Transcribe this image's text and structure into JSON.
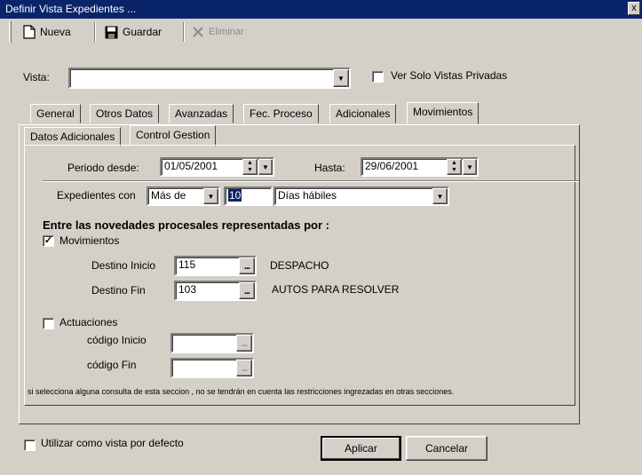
{
  "window": {
    "title": "Definir Vista Expedientes ...",
    "close_glyph": "x"
  },
  "toolbar": {
    "new_label": "Nueva",
    "save_label": "Guardar",
    "delete_label": "Eliminar"
  },
  "vista": {
    "label": "Vista:",
    "value": "",
    "private_only_label": "Ver Solo Vistas Privadas",
    "private_only_checked": false
  },
  "tabs_main": [
    "General",
    "Otros Datos",
    "Avanzadas",
    "Fec. Proceso",
    "Adicionales",
    "Movimientos"
  ],
  "tabs_main_active": "Movimientos",
  "tabs_sub": [
    "Datos Adicionales",
    "Control Gestion"
  ],
  "tabs_sub_active": "Control Gestion",
  "periodo": {
    "desde_label": "Periodo desde:",
    "desde_value": "01/05/2001",
    "hasta_label": "Hasta:",
    "hasta_value": "29/06/2001"
  },
  "expedientes": {
    "label": "Expedientes con",
    "comparator": "Más de",
    "days": "10",
    "day_type": "Días hábiles"
  },
  "novedades": {
    "heading": "Entre las novedades procesales representadas por :"
  },
  "movimientos": {
    "label": "Movimientos",
    "checked": true,
    "inicio_label": "Destino Inicio",
    "inicio_code": "115",
    "inicio_desc": "DESPACHO",
    "fin_label": "Destino Fin",
    "fin_code": "103",
    "fin_desc": "AUTOS PARA RESOLVER"
  },
  "actuaciones": {
    "label": "Actuaciones",
    "checked": false,
    "inicio_label": "código Inicio",
    "inicio_code": "",
    "fin_label": "código Fin",
    "fin_code": ""
  },
  "note": "si selecciona alguna consulta de esta seccion , no se tendrán en cuenta las restricciones ingrezadas en otras secciones.",
  "footer": {
    "default_view_label": "Utilizar como vista por defecto",
    "default_view_checked": false,
    "apply_label": "Aplicar",
    "cancel_label": "Cancelar"
  },
  "icons": {
    "new": "new-document-icon",
    "save": "floppy-disk-icon",
    "delete": "x-delete-icon",
    "ellipsis": "...",
    "dropdown": "chevron-down-icon"
  },
  "colors": {
    "titlebar": "#0a246a",
    "face": "#d4d0c8",
    "highlight": "#0a246a"
  }
}
